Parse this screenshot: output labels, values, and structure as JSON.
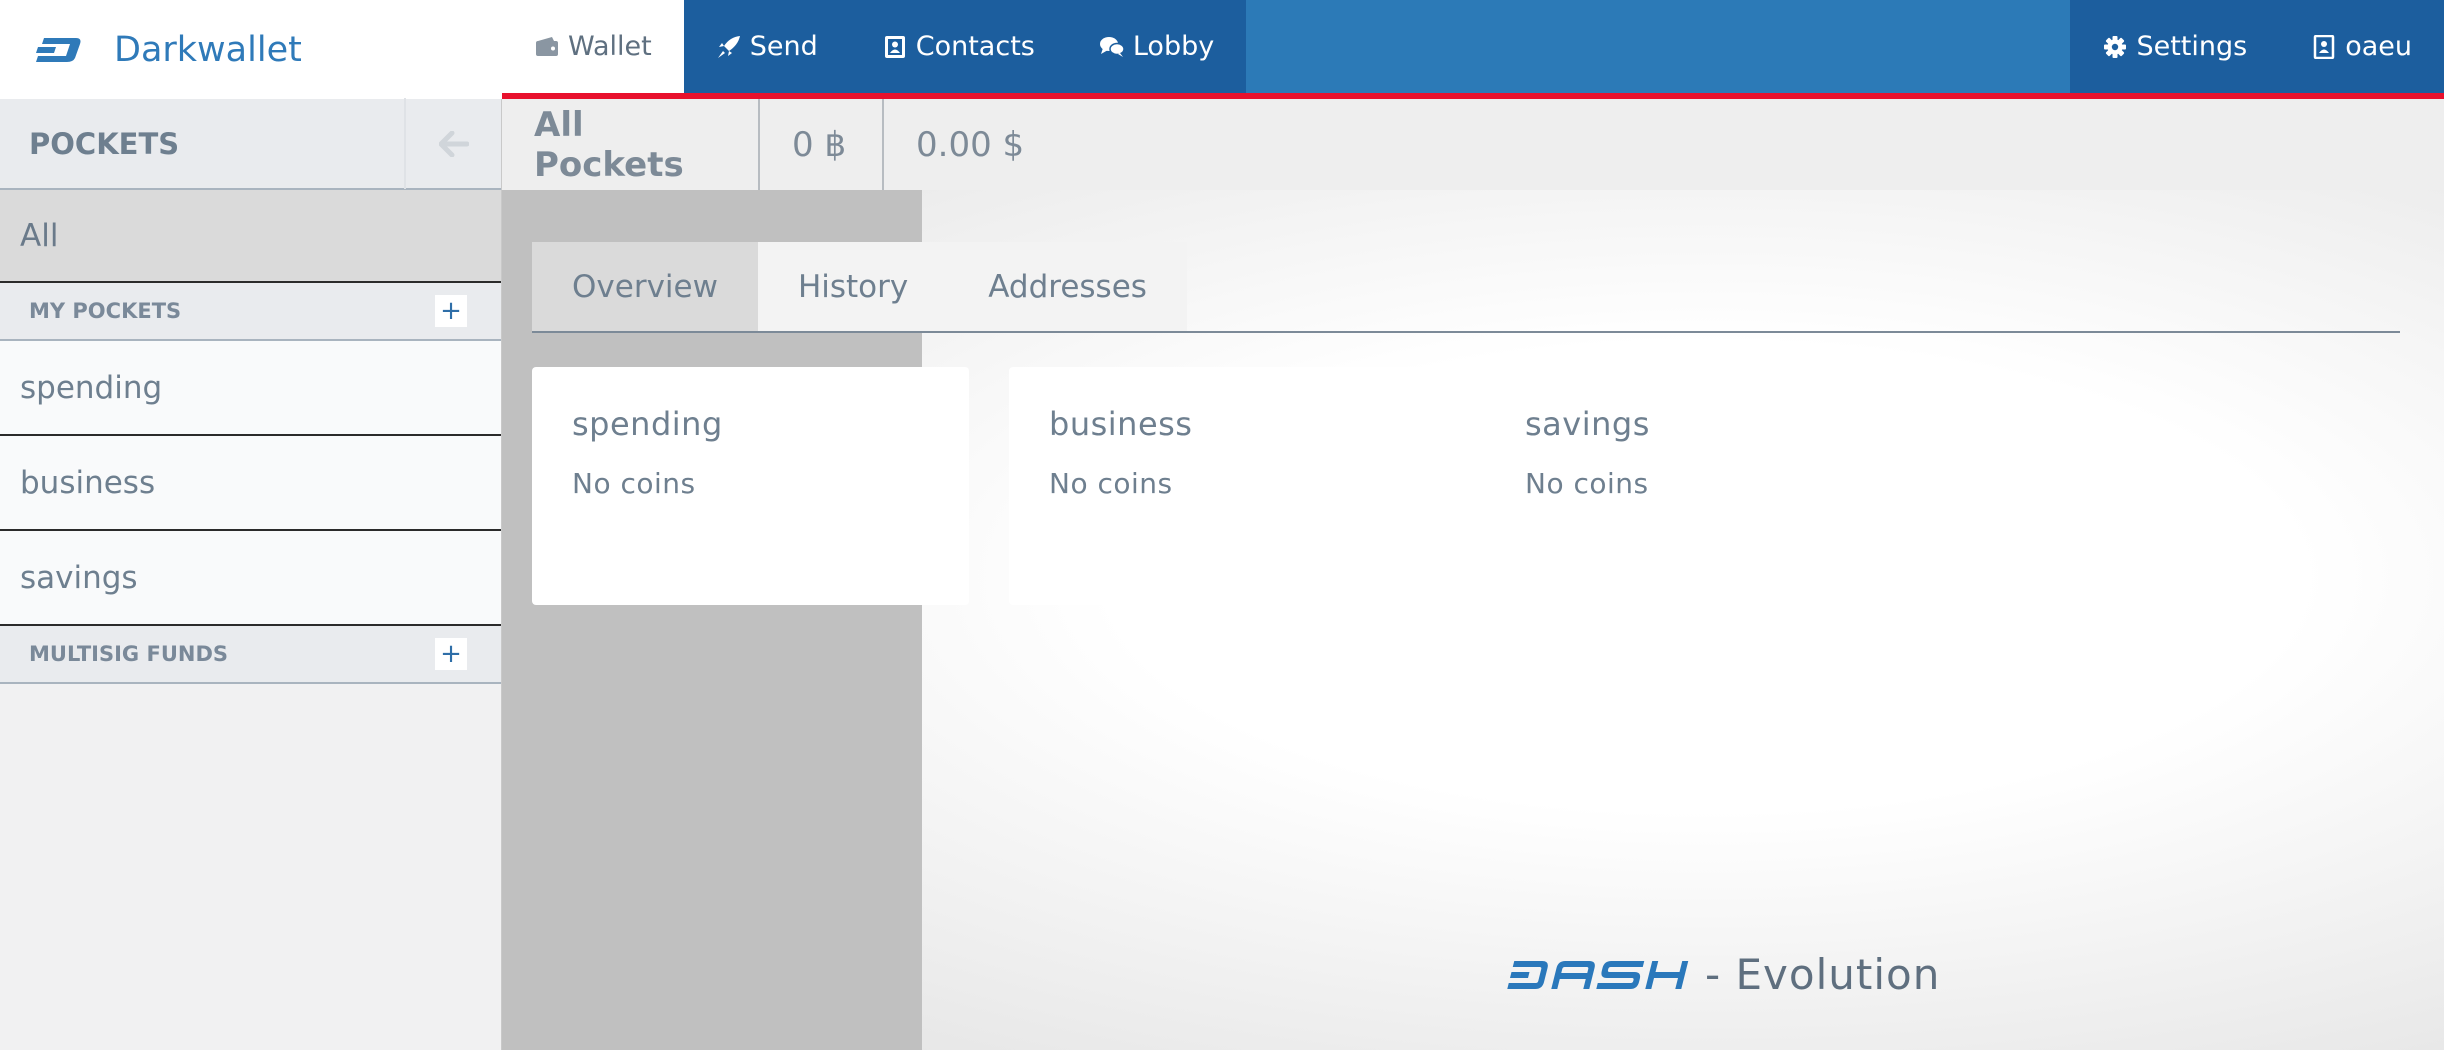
{
  "app": {
    "brand_name": "Darkwallet",
    "accent_color": "#2c7ab7",
    "nav_dark_color": "#1c5e9e",
    "highlight_color": "#e8112d"
  },
  "nav": {
    "tabs": [
      {
        "label": "Wallet",
        "icon": "wallet-icon",
        "active": true
      },
      {
        "label": "Send",
        "icon": "rocket-icon"
      },
      {
        "label": "Contacts",
        "icon": "address-book-icon"
      },
      {
        "label": "Lobby",
        "icon": "chat-bubbles-icon"
      }
    ],
    "right": [
      {
        "label": "Settings",
        "icon": "gear-icon"
      },
      {
        "label": "oaeu",
        "icon": "user-card-icon"
      }
    ]
  },
  "sidebar": {
    "title": "POCKETS",
    "all_label": "All",
    "my_pockets_label": "MY POCKETS",
    "pockets": [
      "spending",
      "business",
      "savings"
    ],
    "multisig_label": "MULTISIG FUNDS",
    "add_symbol": "+"
  },
  "header": {
    "title": "All Pockets",
    "btc_balance": "0 ฿",
    "fiat_balance": "0.00 $"
  },
  "content": {
    "tabs": [
      "Overview",
      "History",
      "Addresses"
    ],
    "active_tab": "Overview",
    "cards": [
      {
        "name": "spending",
        "status": "No coins"
      },
      {
        "name": "business",
        "status": "No coins"
      },
      {
        "name": "savings",
        "status": "No coins"
      }
    ]
  },
  "footer": {
    "logo_text": "DASH",
    "tagline": "- Evolution"
  }
}
